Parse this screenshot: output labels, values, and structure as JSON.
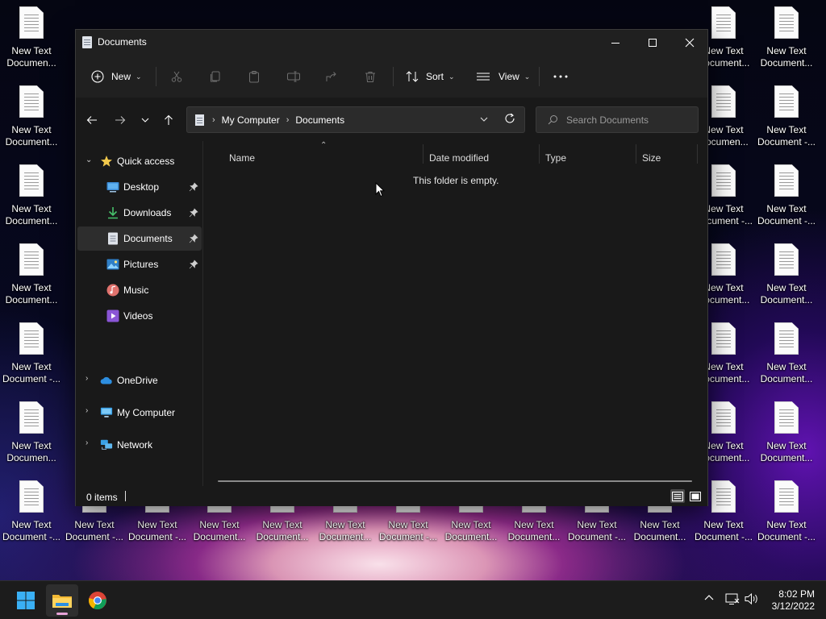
{
  "desktop": {
    "icons": [
      {
        "label": "New Text Documen..."
      },
      {
        "label": "New Text Document..."
      },
      {
        "label": "New Text Document..."
      },
      {
        "label": "New Text Document..."
      },
      {
        "label": "New Text Document -..."
      },
      {
        "label": "New Text Documen..."
      },
      {
        "label": "New Text Document -..."
      },
      {
        "label": "New Text Document -..."
      },
      {
        "label": "New Text Document -..."
      },
      {
        "label": "New Text Document..."
      },
      {
        "label": "New Text Document..."
      },
      {
        "label": "New Text Document..."
      },
      {
        "label": "New Text Document -..."
      },
      {
        "label": "New Text Document..."
      },
      {
        "label": "New Text Document..."
      },
      {
        "label": "New Text Document -..."
      },
      {
        "label": "New Text Document..."
      },
      {
        "label": "New Text Document..."
      },
      {
        "label": "New Text Documen..."
      },
      {
        "label": "New Text Document -..."
      },
      {
        "label": "New Text Document..."
      },
      {
        "label": "New Text Document..."
      },
      {
        "label": "New Text Document..."
      },
      {
        "label": "New Text Document -..."
      },
      {
        "label": "New Text Document..."
      },
      {
        "label": "New Text Document -..."
      },
      {
        "label": "New Text Document -..."
      },
      {
        "label": "New Text Document..."
      },
      {
        "label": "New Text Document..."
      },
      {
        "label": "New Text Document..."
      },
      {
        "label": "New Text Document -..."
      }
    ]
  },
  "window": {
    "title": "Documents",
    "commandbar": {
      "new_label": "New",
      "sort_label": "Sort",
      "view_label": "View"
    },
    "address": {
      "crumbs": [
        "My Computer",
        "Documents"
      ]
    },
    "search": {
      "placeholder": "Search Documents"
    },
    "navpane": {
      "quick_access": "Quick access",
      "items": [
        {
          "label": "Desktop"
        },
        {
          "label": "Downloads"
        },
        {
          "label": "Documents"
        },
        {
          "label": "Pictures"
        },
        {
          "label": "Music"
        },
        {
          "label": "Videos"
        }
      ],
      "onedrive": "OneDrive",
      "my_computer": "My Computer",
      "network": "Network"
    },
    "columns": [
      "Name",
      "Date modified",
      "Type",
      "Size"
    ],
    "empty_message": "This folder is empty.",
    "status": {
      "item_count": "0 items"
    }
  },
  "taskbar": {
    "time": "8:02 PM",
    "date": "3/12/2022"
  }
}
